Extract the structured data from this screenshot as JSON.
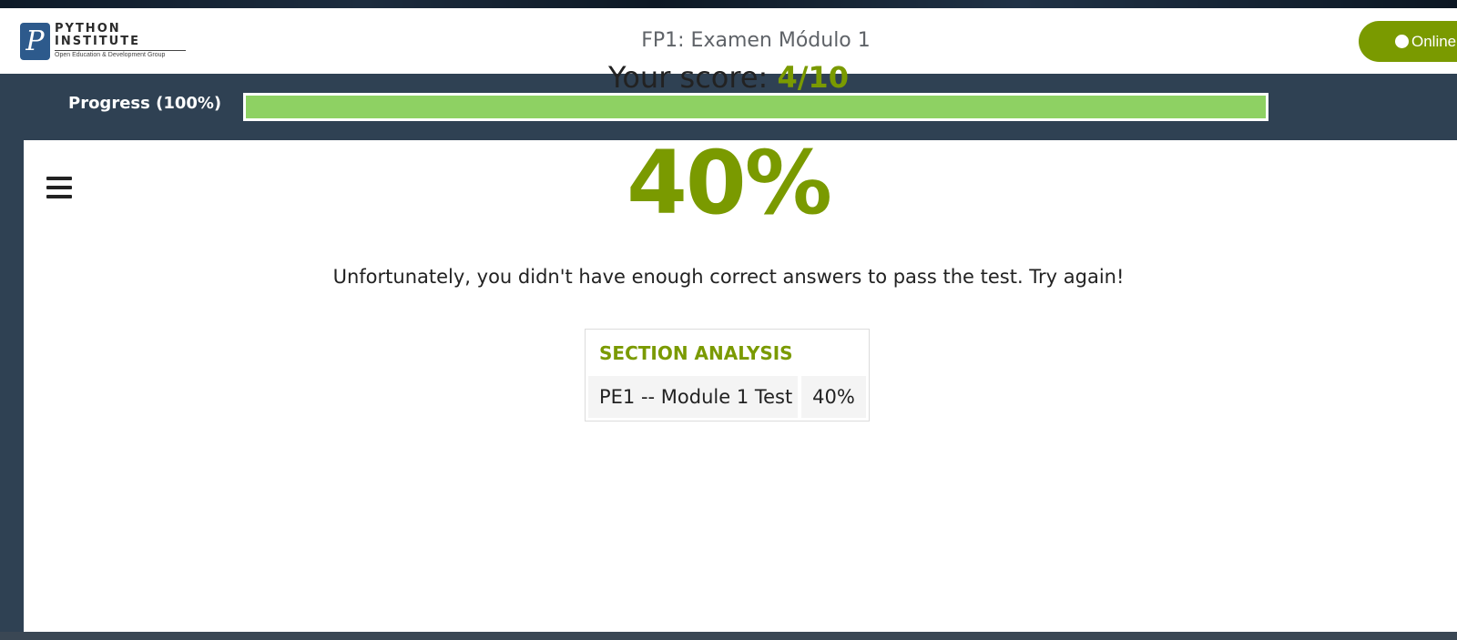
{
  "header": {
    "logo": {
      "mark": "P",
      "line1": "PYTHON",
      "line2": "INSTITUTE",
      "subtitle": "Open Education & Development Group"
    },
    "title": "FP1: Examen Módulo 1",
    "status_button": "Online"
  },
  "progress": {
    "label": "Progress (100%)",
    "value_percent": 100,
    "fill_color": "#8ed163"
  },
  "main": {
    "menu_icon": "hamburger-menu-icon",
    "score_label": "Your score: ",
    "score_value": "4/10",
    "percent": "40%",
    "message": "Unfortunately, you didn't have enough correct answers to pass the test. Try again!",
    "section_analysis": {
      "title": "SECTION ANALYSIS",
      "rows": [
        {
          "name": "PE1 -- Module 1 Test",
          "percent": "40%"
        }
      ]
    }
  },
  "colors": {
    "accent": "#7a9a00",
    "header_bg": "#ffffff",
    "page_bg": "#2f4153"
  }
}
